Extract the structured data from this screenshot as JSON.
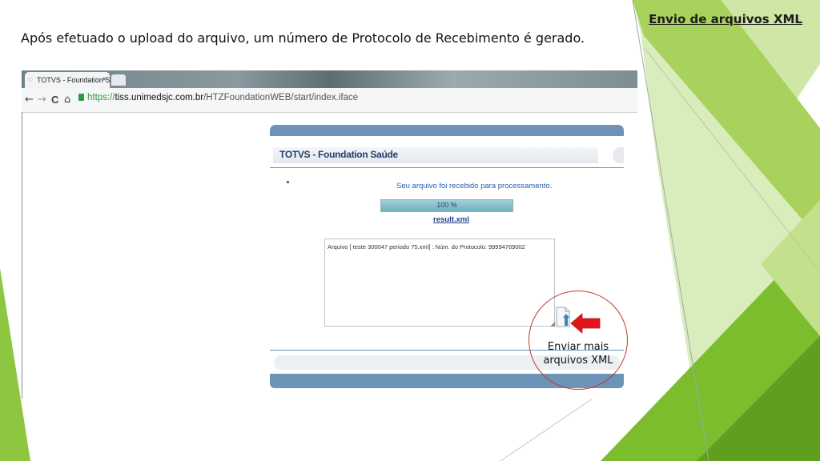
{
  "slide": {
    "title": "Envio de arquivos XML",
    "subtitle": "Após efetuado o upload do arquivo, um número de Protocolo de Recebimento é gerado."
  },
  "browser": {
    "tab_title": "TOTVS - Foundation Saúd",
    "tab_close": "×",
    "url_scheme": "https://",
    "url_domain": "tiss.unimedsjc.com.br",
    "url_path": "/HTZFoundationWEB/start/index.iface",
    "nav": {
      "back": "←",
      "forward": "→",
      "reload": "C",
      "home": "⌂"
    }
  },
  "app": {
    "title": "TOTVS - Foundation Saúde",
    "message": "Seu arquivo foi recebido para processamento.",
    "progress_percent": 100,
    "progress_label": "100 %",
    "result_link": "result.xml",
    "log_text": "Arquivo [ teste 300047 periodo 75.xml] : Núm. do Protocolo: 99994769002"
  },
  "callout": {
    "text": "Enviar mais arquivos XML",
    "icon": "document-upload-icon"
  },
  "colors": {
    "accent_green": "#8dc63f",
    "app_blue": "#6d93b6",
    "title_blue": "#223f69",
    "callout_red": "#c0392b",
    "arrow_red": "#e2161a"
  }
}
